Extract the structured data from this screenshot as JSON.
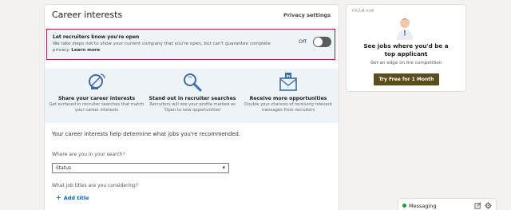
{
  "career_interests": {
    "title": "Career interests",
    "privacy_settings": "Privacy settings",
    "recruiters_alert": {
      "title": "Let recruiters know you're open",
      "description": "We take steps not to show your current company that you're open, but can't guarantee complete privacy.",
      "learn_more": "Learn more",
      "toggle_label": "Off",
      "toggle_state": "off"
    },
    "features": [
      {
        "icon": "satellite-dish-icon",
        "title": "Share your career interests",
        "description": "Get surfaced in recruiter searches that match your career interests"
      },
      {
        "icon": "magnifier-icon",
        "title": "Stand out in recruiter searches",
        "description": "Recruiters will see your profile marked as 'Open to new opportunities'"
      },
      {
        "icon": "linkedin-mail-icon",
        "title": "Receive more opportunities",
        "description": "Double your chances of receiving relevant messages from recruiters"
      }
    ],
    "intro": "Your career interests help determine what jobs you're recommended.",
    "search_question": "Where are you in your search?",
    "search_status_value": "Status",
    "job_titles_question": "What job titles are you considering?",
    "add_title_label": "Add title"
  },
  "premium_ad": {
    "label": "PREMIUM",
    "title_line1": "See jobs where you'd be a",
    "title_line2": "top applicant",
    "subtitle": "Get an edge on the competition",
    "cta": "Try Free for 1 Month"
  },
  "messaging": {
    "label": "Messaging",
    "status_color": "#1a9b3e"
  }
}
